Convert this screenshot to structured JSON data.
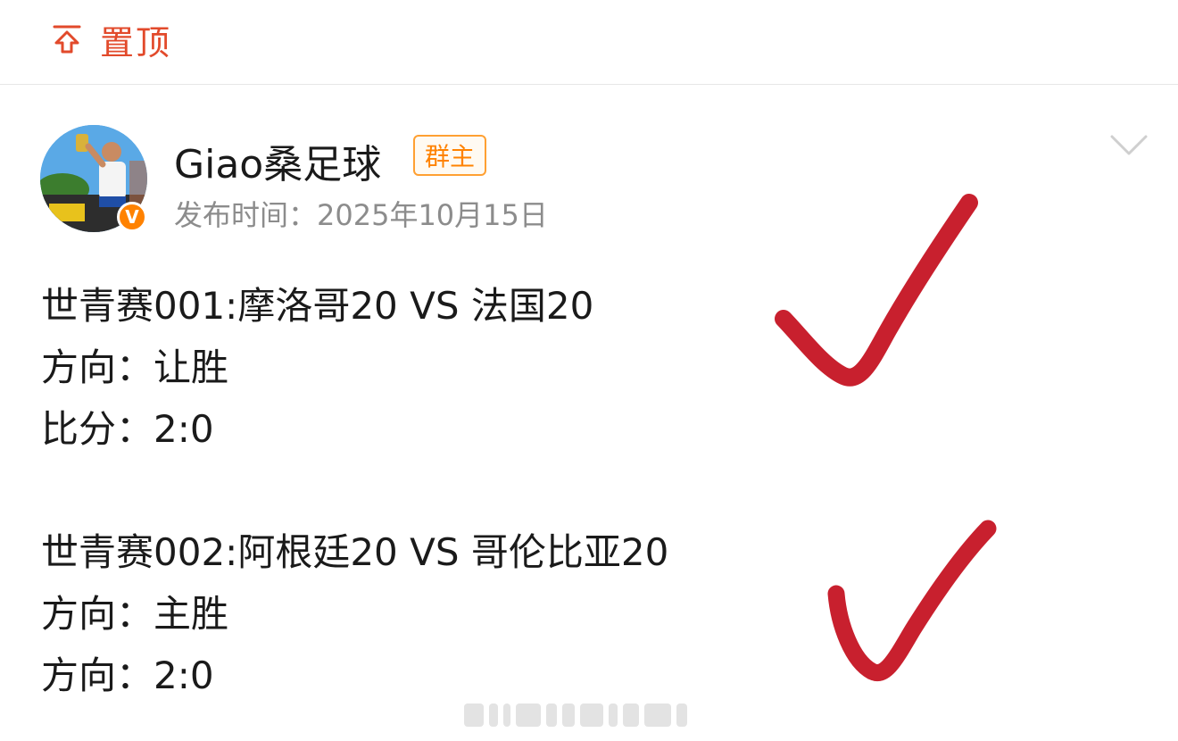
{
  "pin": {
    "icon": "pin-top-icon",
    "label": "置顶",
    "color": "#e24a2b"
  },
  "post": {
    "author": "Giao桑足球",
    "role_badge": "群主",
    "date": "发布时间：2025年10月15日",
    "verified": true,
    "verified_mark": "V",
    "accent": "#ff8200"
  },
  "matches": [
    {
      "title": "世青赛001:摩洛哥20 VS 法国20",
      "line2": "方向：让胜",
      "line3": "比分：2:0",
      "result_icon": "red-check-icon"
    },
    {
      "title": "世青赛002:阿根廷20 VS 哥伦比亚20",
      "line2": "方向：主胜",
      "line3": "方向：2:0",
      "result_icon": "red-check-icon"
    }
  ]
}
